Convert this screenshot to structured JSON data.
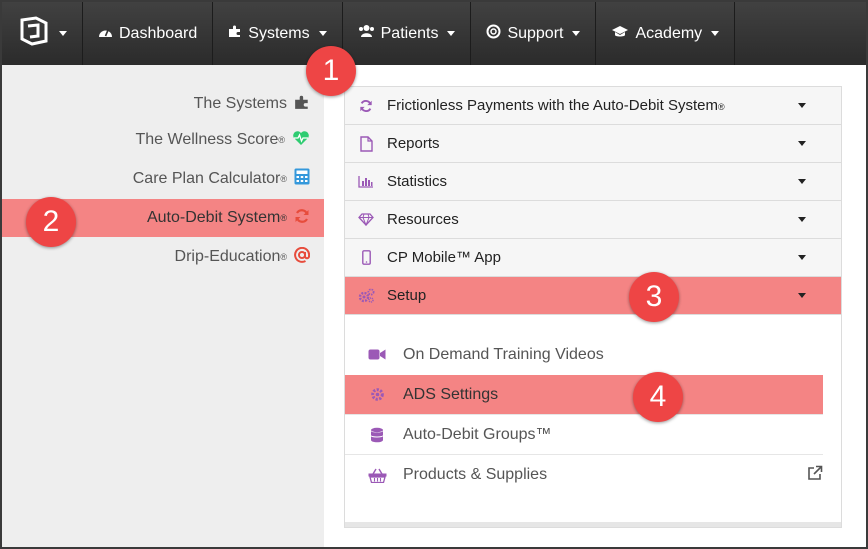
{
  "navbar": {
    "items": [
      {
        "label": "Dashboard",
        "icon": "dashboard-icon"
      },
      {
        "label": "Systems",
        "icon": "puzzle-icon"
      },
      {
        "label": "Patients",
        "icon": "users-icon"
      },
      {
        "label": "Support",
        "icon": "lifebuoy-icon"
      },
      {
        "label": "Academy",
        "icon": "graduation-cap-icon"
      }
    ]
  },
  "sidebar": {
    "items": [
      {
        "label": "The Systems",
        "reg": "",
        "icon": "puzzle-icon"
      },
      {
        "label": "The Wellness Score",
        "reg": "®",
        "icon": "heartbeat-icon"
      },
      {
        "label": "Care Plan Calculator",
        "reg": "®",
        "icon": "calculator-icon"
      },
      {
        "label": "Auto-Debit System",
        "reg": "®",
        "icon": "refresh-icon"
      },
      {
        "label": "Drip-Education",
        "reg": "®",
        "icon": "at-icon"
      }
    ]
  },
  "accordion": {
    "items": [
      {
        "label": "Frictionless Payments with the Auto-Debit System",
        "reg": "®",
        "icon": "refresh-icon"
      },
      {
        "label": "Reports",
        "reg": "",
        "icon": "document-icon"
      },
      {
        "label": "Statistics",
        "reg": "",
        "icon": "bar-chart-icon"
      },
      {
        "label": "Resources",
        "reg": "",
        "icon": "diamond-icon"
      },
      {
        "label": "CP Mobile™ App",
        "reg": "",
        "icon": "mobile-icon"
      },
      {
        "label": "Setup",
        "reg": "",
        "icon": "gears-icon"
      }
    ]
  },
  "setup_menu": {
    "items": [
      {
        "label": "On Demand Training Videos",
        "icon": "video-camera-icon"
      },
      {
        "label": "ADS Settings",
        "icon": "gear-icon"
      },
      {
        "label": "Auto-Debit Groups™",
        "icon": "database-icon"
      },
      {
        "label": "Products & Supplies",
        "icon": "basket-icon"
      }
    ]
  },
  "badges": [
    "1",
    "2",
    "3",
    "4"
  ],
  "colors": {
    "navbar_bg": "#333333",
    "highlight": "#f48484",
    "badge": "#ee4545",
    "icon_purple": "#9b59b6",
    "icon_red": "#e74c3c",
    "icon_green": "#2ecc71",
    "icon_blue": "#3498db"
  }
}
